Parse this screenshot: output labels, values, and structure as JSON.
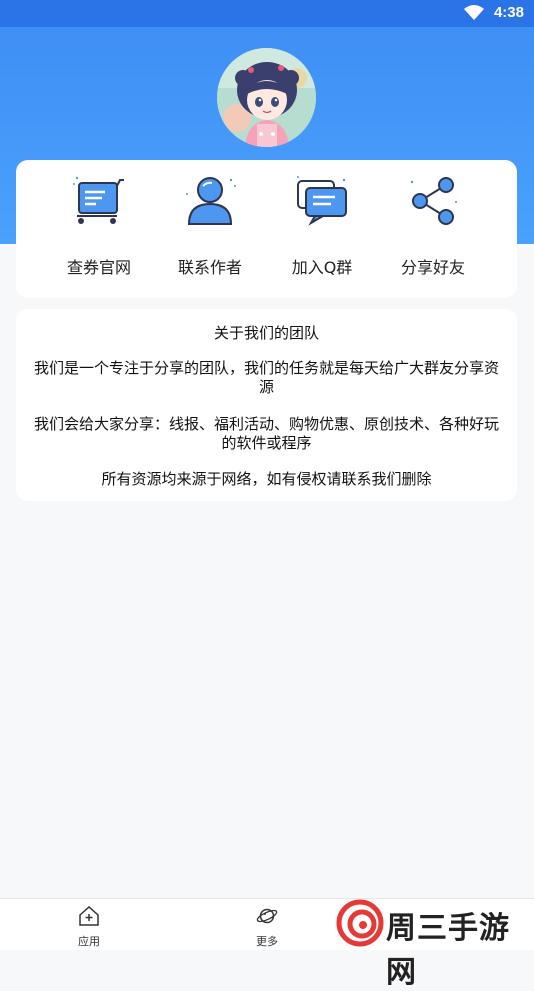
{
  "status_bar": {
    "time": "4:38",
    "icons": [
      "wifi-icon",
      "battery-icon"
    ]
  },
  "profile": {
    "avatar": "anime-girl-avatar"
  },
  "menu": [
    {
      "label": "查券官网",
      "icon": "cart-icon"
    },
    {
      "label": "联系作者",
      "icon": "person-icon"
    },
    {
      "label": "加入Q群",
      "icon": "chat-icon"
    },
    {
      "label": "分享好友",
      "icon": "share-icon"
    }
  ],
  "about": {
    "title": "关于我们的团队",
    "paragraphs": [
      [
        "我们是一个专注于分享的团队，我们的任务就是每天给广大群友分享资",
        "源"
      ],
      [
        "我们会给大家分享：线报、福利活动、购物优惠、原创技术、各种好玩",
        "的软件或程序"
      ],
      [
        "所有资源均来源于网络，如有侵权请联系我们删除"
      ]
    ]
  },
  "bottom_nav": [
    {
      "label": "应用",
      "icon": "home-plus-icon"
    },
    {
      "label": "更多",
      "icon": "planet-icon"
    }
  ],
  "watermark": {
    "text": "周三手游网"
  },
  "colors": {
    "primary": "#3f8ff5",
    "status": "#2b74e8",
    "icon_blue": "#3d8ef0"
  }
}
